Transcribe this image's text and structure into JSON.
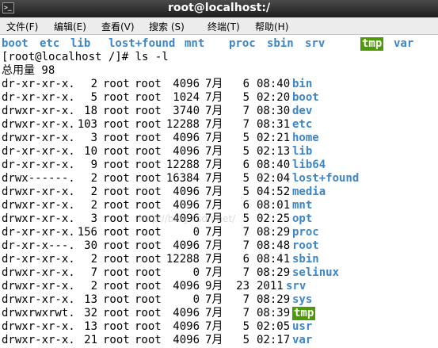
{
  "window": {
    "title": "root@localhost:/"
  },
  "menu": [
    "文件(F)",
    "编辑(E)",
    "查看(V)",
    "搜索 (S)",
    "终端(T)",
    "帮助(H)"
  ],
  "top_listing": [
    "boot",
    "etc",
    "lib",
    "lost+found",
    "mnt",
    "proc",
    "sbin",
    "srv",
    "tmp",
    "var"
  ],
  "prompt": "[root@localhost /]# ls -l",
  "total": "总用量 98",
  "rows": [
    {
      "perm": "dr-xr-xr-x.",
      "links": "2",
      "owner": "root",
      "group": "root",
      "size": "4096",
      "month": "7月",
      "day": "6",
      "time": "08:40",
      "name": "bin"
    },
    {
      "perm": "dr-xr-xr-x.",
      "links": "5",
      "owner": "root",
      "group": "root",
      "size": "1024",
      "month": "7月",
      "day": "5",
      "time": "02:20",
      "name": "boot"
    },
    {
      "perm": "drwxr-xr-x.",
      "links": "18",
      "owner": "root",
      "group": "root",
      "size": "3740",
      "month": "7月",
      "day": "7",
      "time": "08:30",
      "name": "dev"
    },
    {
      "perm": "drwxr-xr-x.",
      "links": "103",
      "owner": "root",
      "group": "root",
      "size": "12288",
      "month": "7月",
      "day": "7",
      "time": "08:31",
      "name": "etc"
    },
    {
      "perm": "drwxr-xr-x.",
      "links": "3",
      "owner": "root",
      "group": "root",
      "size": "4096",
      "month": "7月",
      "day": "5",
      "time": "02:21",
      "name": "home"
    },
    {
      "perm": "dr-xr-xr-x.",
      "links": "10",
      "owner": "root",
      "group": "root",
      "size": "4096",
      "month": "7月",
      "day": "5",
      "time": "02:13",
      "name": "lib"
    },
    {
      "perm": "dr-xr-xr-x.",
      "links": "9",
      "owner": "root",
      "group": "root",
      "size": "12288",
      "month": "7月",
      "day": "6",
      "time": "08:40",
      "name": "lib64"
    },
    {
      "perm": "drwx------.",
      "links": "2",
      "owner": "root",
      "group": "root",
      "size": "16384",
      "month": "7月",
      "day": "5",
      "time": "02:04",
      "name": "lost+found"
    },
    {
      "perm": "drwxr-xr-x.",
      "links": "2",
      "owner": "root",
      "group": "root",
      "size": "4096",
      "month": "7月",
      "day": "5",
      "time": "04:52",
      "name": "media"
    },
    {
      "perm": "drwxr-xr-x.",
      "links": "2",
      "owner": "root",
      "group": "root",
      "size": "4096",
      "month": "7月",
      "day": "6",
      "time": "08:01",
      "name": "mnt"
    },
    {
      "perm": "drwxr-xr-x.",
      "links": "3",
      "owner": "root",
      "group": "root",
      "size": "4096",
      "month": "7月",
      "day": "5",
      "time": "02:25",
      "name": "opt"
    },
    {
      "perm": "dr-xr-xr-x.",
      "links": "156",
      "owner": "root",
      "group": "root",
      "size": "0",
      "month": "7月",
      "day": "7",
      "time": "08:29",
      "name": "proc"
    },
    {
      "perm": "dr-xr-x---.",
      "links": "30",
      "owner": "root",
      "group": "root",
      "size": "4096",
      "month": "7月",
      "day": "7",
      "time": "08:48",
      "name": "root"
    },
    {
      "perm": "dr-xr-xr-x.",
      "links": "2",
      "owner": "root",
      "group": "root",
      "size": "12288",
      "month": "7月",
      "day": "6",
      "time": "08:41",
      "name": "sbin"
    },
    {
      "perm": "drwxr-xr-x.",
      "links": "7",
      "owner": "root",
      "group": "root",
      "size": "0",
      "month": "7月",
      "day": "7",
      "time": "08:29",
      "name": "selinux"
    },
    {
      "perm": "drwxr-xr-x.",
      "links": "2",
      "owner": "root",
      "group": "root",
      "size": "4096",
      "month": "9月",
      "day": "23",
      "time": "2011",
      "name": "srv"
    },
    {
      "perm": "drwxr-xr-x.",
      "links": "13",
      "owner": "root",
      "group": "root",
      "size": "0",
      "month": "7月",
      "day": "7",
      "time": "08:29",
      "name": "sys"
    },
    {
      "perm": "drwxrwxrwt.",
      "links": "32",
      "owner": "root",
      "group": "root",
      "size": "4096",
      "month": "7月",
      "day": "7",
      "time": "08:39",
      "name": "tmp"
    },
    {
      "perm": "drwxr-xr-x.",
      "links": "13",
      "owner": "root",
      "group": "root",
      "size": "4096",
      "month": "7月",
      "day": "5",
      "time": "02:05",
      "name": "usr"
    },
    {
      "perm": "drwxr-xr-x.",
      "links": "21",
      "owner": "root",
      "group": "root",
      "size": "4096",
      "month": "7月",
      "day": "5",
      "time": "02:17",
      "name": "var"
    }
  ],
  "watermark": "http://blog.csdn.net/",
  "colors": {
    "directory": "#3d86c6",
    "sticky_dir_bg": "#4e9a06",
    "titlebar": "#2b2b2b"
  },
  "icons": {
    "app": "terminal-icon"
  }
}
